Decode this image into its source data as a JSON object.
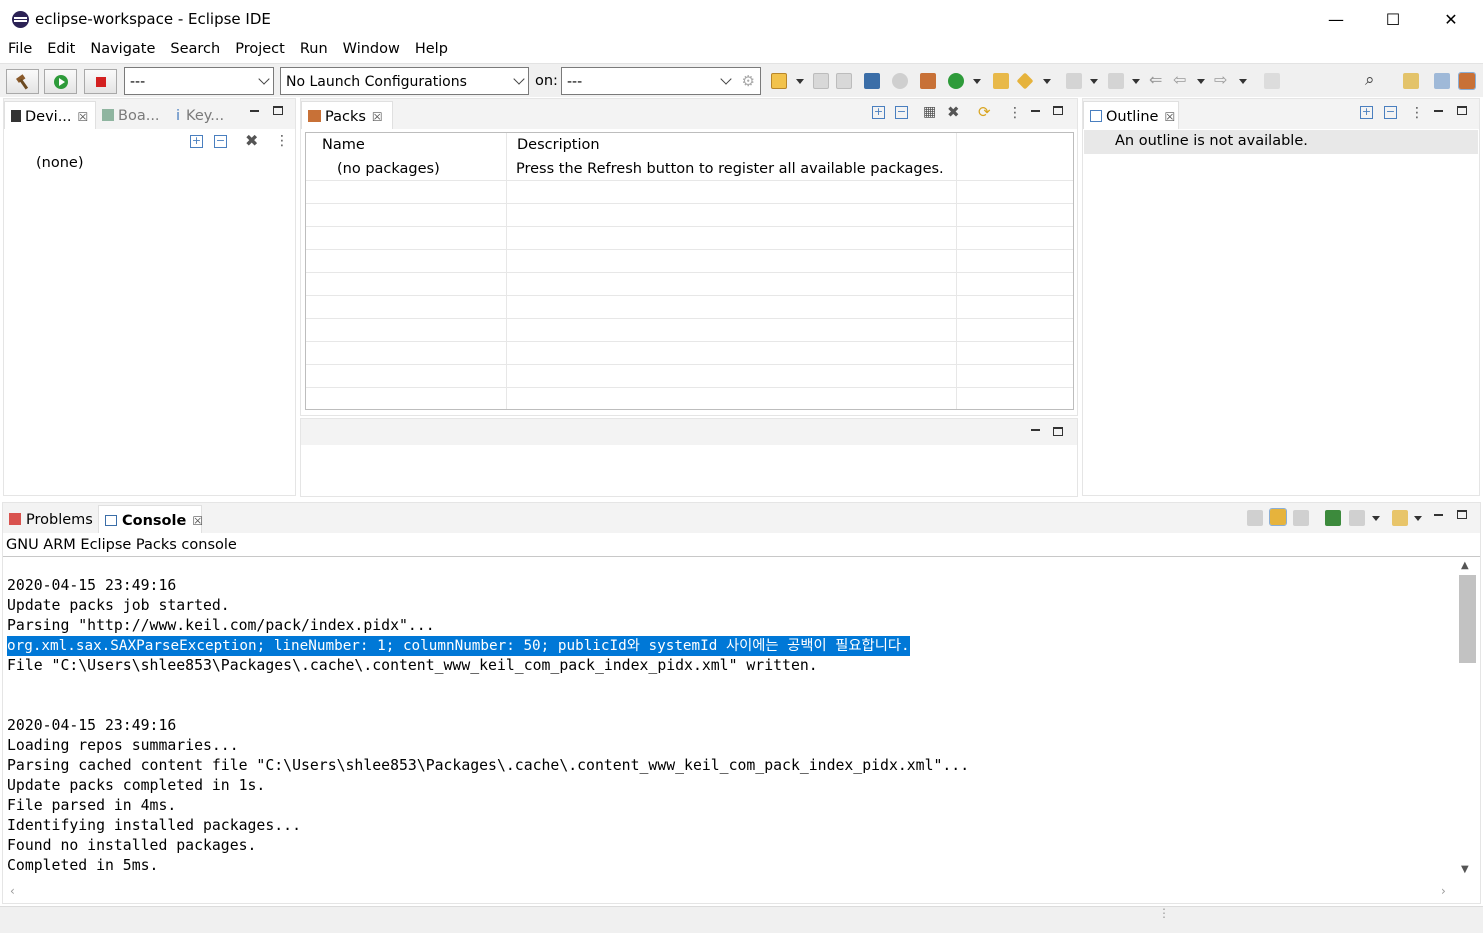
{
  "window": {
    "title": "eclipse-workspace - Eclipse IDE",
    "controls": {
      "minimize": "—",
      "maximize": "☐",
      "close": "✕"
    }
  },
  "menu": [
    "File",
    "Edit",
    "Navigate",
    "Search",
    "Project",
    "Run",
    "Window",
    "Help"
  ],
  "toolbar": {
    "mode_combo": "---",
    "launch_combo": "No Launch Configurations",
    "on_label": "on:",
    "target_combo": "---"
  },
  "left_panel": {
    "tabs": [
      "Devi...",
      "Boa...",
      "Key..."
    ],
    "content": "(none)"
  },
  "packs_panel": {
    "tab": "Packs",
    "columns": [
      "Name",
      "Description"
    ],
    "rows": [
      {
        "name": "(no packages)",
        "description": "Press the Refresh button to register all available packages."
      }
    ]
  },
  "outline_panel": {
    "tab": "Outline",
    "message": "An outline is not available."
  },
  "bottom_panel": {
    "tabs": [
      "Problems",
      "Console"
    ],
    "active_tab": "Console",
    "console_title": "GNU ARM Eclipse Packs console",
    "lines": [
      "",
      "2020-04-15 23:49:16",
      "Update packs job started.",
      "Parsing \"http://www.keil.com/pack/index.pidx\"...",
      "org.xml.sax.SAXParseException; lineNumber: 1; columnNumber: 50; publicId와 systemId 사이에는 공백이 필요합니다.",
      "File \"C:\\Users\\shlee853\\Packages\\.cache\\.content_www_keil_com_pack_index_pidx.xml\" written.",
      "",
      "",
      "2020-04-15 23:49:16",
      "Loading repos summaries...",
      "Parsing cached content file \"C:\\Users\\shlee853\\Packages\\.cache\\.content_www_keil_com_pack_index_pidx.xml\"...",
      "Update packs completed in 1s.",
      "File parsed in 4ms.",
      "Identifying installed packages...",
      "Found no installed packages.",
      "Completed in 5ms."
    ]
  },
  "colors": {
    "selection": "#0078d7",
    "panel_header": "#f3f3f3",
    "toolbar": "#f0f0f0"
  }
}
